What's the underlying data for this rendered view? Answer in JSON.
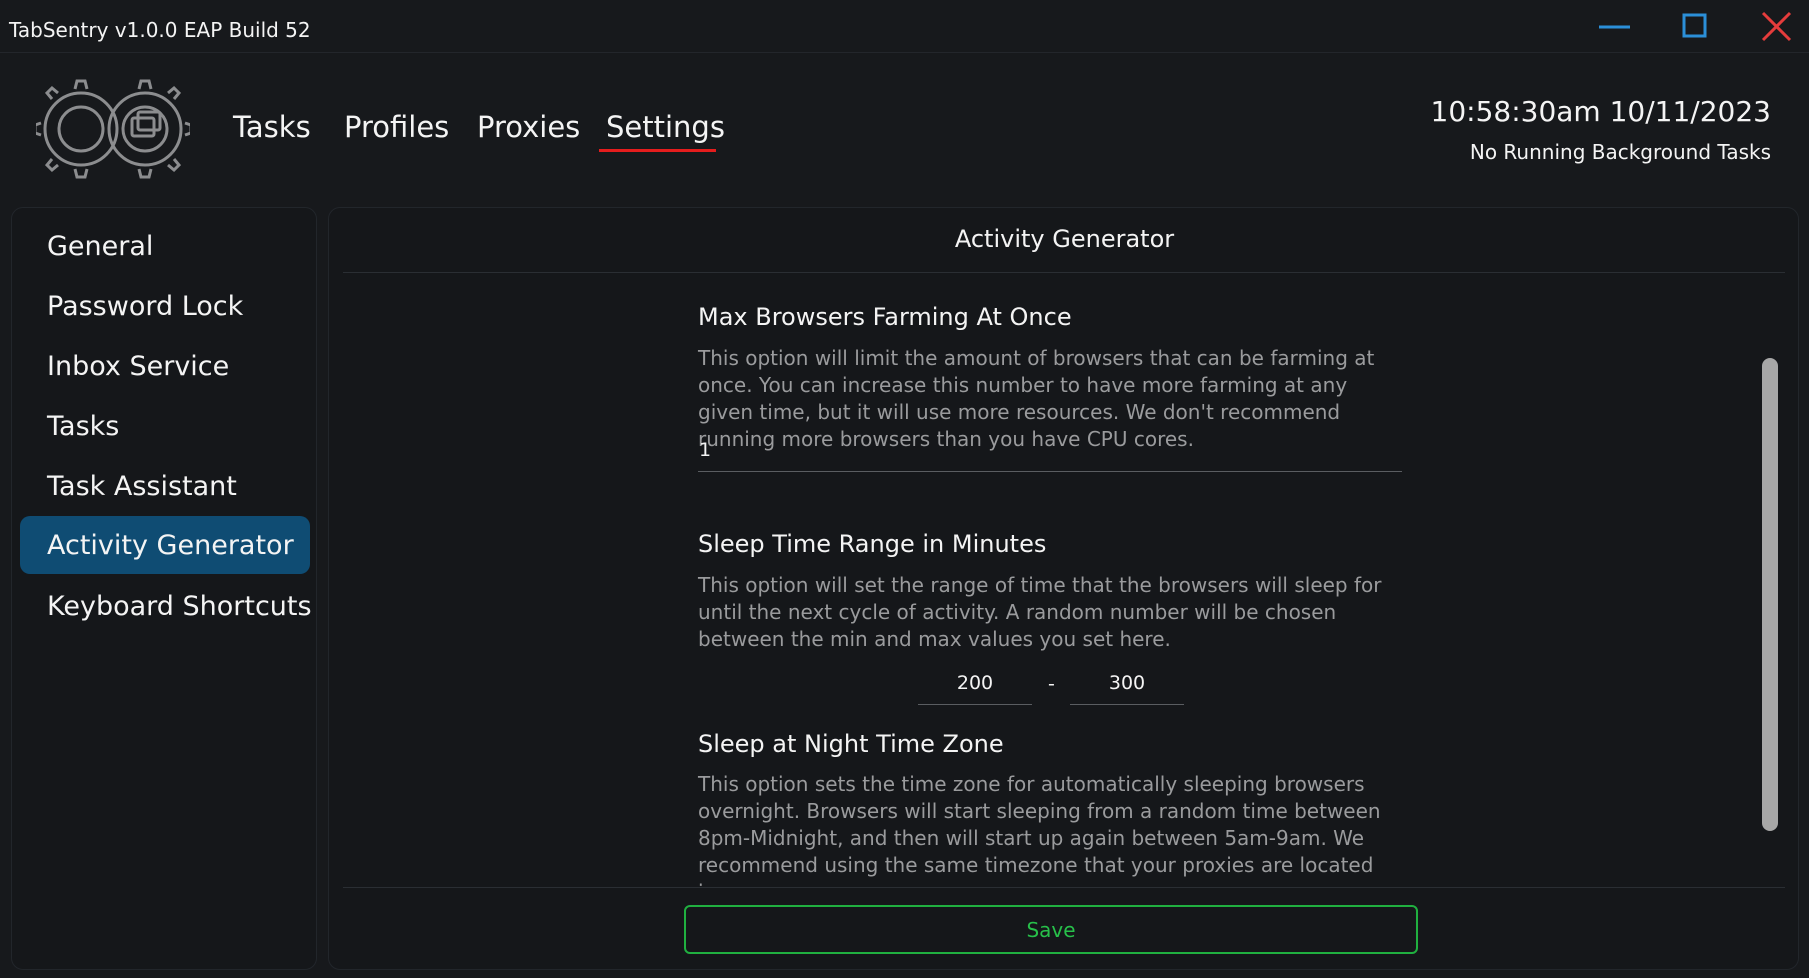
{
  "window": {
    "title": "TabSentry v1.0.0 EAP Build 52",
    "controls": [
      "minimize-icon",
      "maximize-icon",
      "close-icon"
    ]
  },
  "header": {
    "logo_icon": "gear-logo-icon",
    "nav": [
      {
        "label": "Tasks"
      },
      {
        "label": "Profiles"
      },
      {
        "label": "Proxies"
      },
      {
        "label": "Settings",
        "active": true
      }
    ],
    "clock": "10:58:30am 10/11/2023",
    "background_status": "No Running Background Tasks"
  },
  "sidebar": {
    "items": [
      {
        "label": "General"
      },
      {
        "label": "Password Lock"
      },
      {
        "label": "Inbox Service"
      },
      {
        "label": "Tasks"
      },
      {
        "label": "Task Assistant"
      },
      {
        "label": "Activity Generator",
        "active": true
      },
      {
        "label": "Keyboard Shortcuts"
      }
    ]
  },
  "main": {
    "title": "Activity Generator",
    "settings": [
      {
        "title": "Max Browsers Farming At Once",
        "description": "This option will limit the amount of browsers that can be farming at once. You can increase this number to have more farming at any given time, but it will use more resources. We don't recommend running more browsers than you have CPU cores.",
        "value": "1"
      },
      {
        "title": "Sleep Time Range in Minutes",
        "description": "This option will set the range of time that the browsers will sleep for until the next cycle of activity. A random number will be chosen between the min and max values you set here.",
        "min_value": "200",
        "separator": "-",
        "max_value": "300"
      },
      {
        "title": "Sleep at Night Time Zone",
        "description": "This option sets the time zone for automatically sleeping browsers overnight. Browsers will start sleeping from a random time between 8pm-Midnight, and then will start up again between 5am-9am. We recommend using the same timezone that your proxies are located in."
      }
    ],
    "save_label": "Save"
  },
  "colors": {
    "background": "#17191c",
    "panel": "#15171a",
    "active_sidebar": "#0f4c73",
    "nav_underline": "#e51d1d",
    "minimize": "#2b8fd8",
    "maximize": "#2b8fd8",
    "close": "#e53c3c",
    "save": "#27c04a",
    "muted_text": "#9a9b9d"
  }
}
